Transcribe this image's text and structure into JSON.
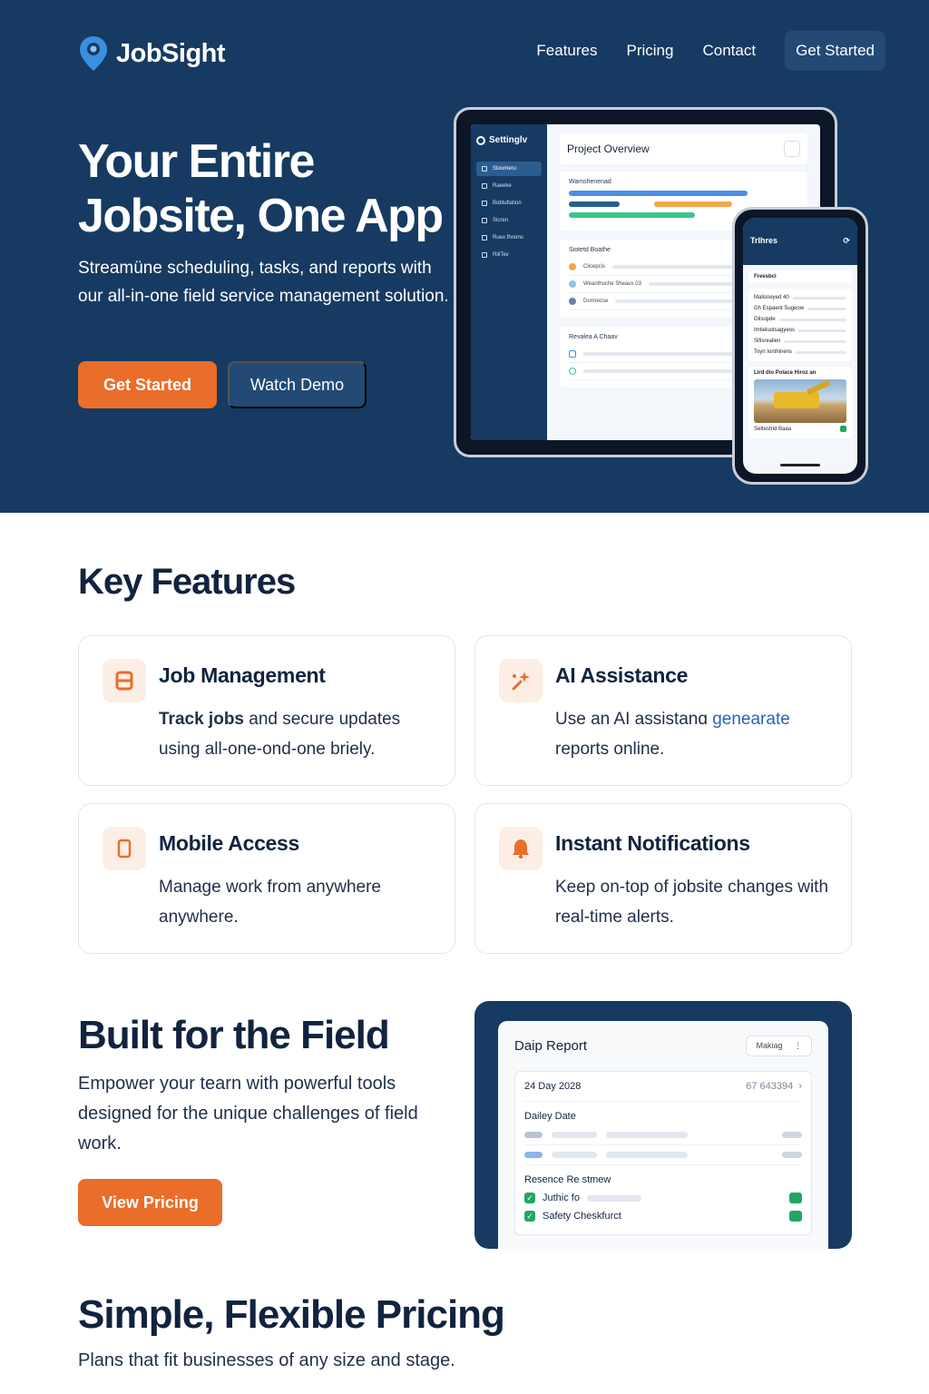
{
  "brand": {
    "name": "JobSight",
    "accent": "#ea6d2a",
    "navy": "#173a62"
  },
  "nav": {
    "items": [
      "Features",
      "Pricing",
      "Contact"
    ],
    "cta": "Get Started"
  },
  "hero": {
    "title": "Your Entire Jobsite, One App",
    "subtitle": "Streamüne scheduling, tasks, and reports with our all-in-one field service management solution.",
    "primary": "Get Started",
    "secondary": "Watch Demo"
  },
  "tablet": {
    "brand": "Settinglv",
    "sidebar": [
      "Stoumeru",
      "Raeeke",
      "Bobtufiation",
      "Sicren",
      "Ruex fhrems",
      "RiliTev"
    ],
    "header": "Project Overview",
    "panel1": "Wamshenenad",
    "panel2": "Siotetd Boathe",
    "panel2_rows": [
      "Clicepcis",
      "Weanthoche Sheaus 03",
      "Domrecse"
    ],
    "panel3": "Revalea A Chaav"
  },
  "phone": {
    "title": "Trlhres",
    "card1": "Freesbcl",
    "rows": [
      "Malisneyed 40",
      "Gh Espaent Sugeow",
      "Glisopde",
      "Imtieluotsagyeos",
      "Sifisreallen",
      "Toyn Ionthinens"
    ],
    "photo_caption": "Lird dio Polace Hiroz an",
    "footer": "Settestrid Baaa"
  },
  "features": {
    "heading": "Key Features",
    "cards": [
      {
        "title": "Job Management",
        "text_bold": "Track jobs",
        "text": " and secure updates using all-one-ond-one briely.",
        "icon": "server-icon"
      },
      {
        "title": "AI Assistance",
        "text": "Use an AI assistanɑ ",
        "text_link": "genearate",
        "text_end": " reports online.",
        "icon": "sparkle-icon"
      },
      {
        "title": "Mobile Access",
        "text": "Manage work from anywhere anywhere.",
        "icon": "phone-icon"
      },
      {
        "title": "Instant Notifications",
        "text": "Keep on-top of jobsite changes with real-time alerts.",
        "icon": "bell-icon"
      }
    ]
  },
  "field": {
    "heading": "Built for the Field",
    "text": "Empower your tearn with powerful tools designed for the unique challenges of field work.",
    "cta": "View Pricing",
    "report": {
      "title": "Daip Report",
      "select": "Makiag",
      "date": "24 Day 2028",
      "number": "67 643394",
      "label1": "Dailey Date",
      "label2": "Resence Re stmew",
      "checks": [
        "Juthic fo",
        "Safety Cheskfurct"
      ]
    }
  },
  "pricing": {
    "heading": "Simple, Flexible Pricing",
    "text": "Plans that fit businesses of any size and stage."
  }
}
